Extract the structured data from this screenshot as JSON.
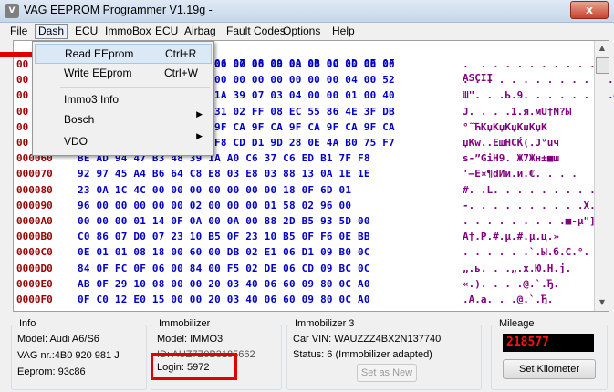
{
  "window": {
    "title": "VAG EEPROM Programmer  V1.19g -",
    "close_glyph": "x",
    "app_icon_text": "V"
  },
  "menubar": {
    "items": [
      "File",
      "Dash",
      "ECU",
      "ImmoBox",
      "ECU",
      "Airbag",
      "Fault Codes",
      "Options",
      "Help"
    ]
  },
  "dash_menu": {
    "items": [
      {
        "label": "Read EEprom",
        "shortcut": "Ctrl+R",
        "submenu": false
      },
      {
        "label": "Write EEprom",
        "shortcut": "Ctrl+W",
        "submenu": false
      },
      {
        "label": "Immo3 Info",
        "shortcut": "",
        "submenu": false
      },
      {
        "label": "Bosch",
        "shortcut": "",
        "submenu": true
      },
      {
        "label": "VDO",
        "shortcut": "",
        "submenu": true
      }
    ],
    "submenu_glyph": "▶"
  },
  "hex_view": {
    "header": {
      "bytes": "06 07 08 09 0A 0B 0C 0D 0E 0F",
      "ascii": "ASCII"
    },
    "rows": [
      {
        "addr": "00",
        "bytes": "00 00 00 00 00 00 00 00 00 00",
        "ascii": ".  . . . . . . . . . . . . . ."
      },
      {
        "addr": "00",
        "bytes": "00 00 00 00 00 00 00 04 00 52",
        "ascii": ". . . . . . . . . . . . . . .R"
      },
      {
        "addr": "00",
        "bytes": "1A 39 07 03 04 00 00 01 00 40",
        "ascii": "Ш\". . .Ь.9. . . . . . . .@"
      },
      {
        "addr": "00",
        "bytes": "31 02 FF 08 EC 55 86 4E 3F DB",
        "ascii": "Ј. . . .1.я.мU†N?Ы"
      },
      {
        "addr": "00",
        "bytes": "9F CA 9F CA 9F CA 9F CA 9F CA",
        "ascii": "°˜ЋКџКџКџКџКџК"
      },
      {
        "addr": "00",
        "bytes": "F8 CD D1 9D 28 0E 4A B0 75 F7",
        "ascii": "џКw..EшНСЌ(.J°uч"
      },
      {
        "addr": "000060",
        "bytes": "BE AD 94 47 B3 48 39 1A A0 C6 37 C6 ED B1 7F F8",
        "ascii": "ѕ-”GiН9. Ж7Жн±■ш"
      },
      {
        "addr": "000070",
        "bytes": "92 97 45 A4 B6 64 C8 E8 03 E8 03 88 13 0A 1E 1E",
        "ascii": "'—E¤¶dИи.и.€. . . ."
      },
      {
        "addr": "000080",
        "bytes": "23 0A 1C 4C 00 00 00 00 00 00 00 18 0F 6D 01",
        "ascii": "#. .L. . . . . . . . .m."
      },
      {
        "addr": "000090",
        "bytes": "96 00 00 00 00 00 02 00 00 00 01 58 02 96 00",
        "ascii": "-. . . . . . . . . .X.-."
      },
      {
        "addr": "0000A0",
        "bytes": "00 00 00 01 14 0F 0A 00 0A 00 88 2D B5 93 5D 00",
        "ascii": ". . . . . . . . .■-µ\"]."
      },
      {
        "addr": "0000B0",
        "bytes": "C0 86 07 D0 07 23 10 B5 0F 23 10 B5 0F F6 0E BB",
        "ascii": "А†.Р.#.µ.#.µ.ц.»"
      },
      {
        "addr": "0000C0",
        "bytes": "0E 01 01 08 18 00 60 00 DB 02 E1 06 D1 09 B0 0C",
        "ascii": ". . . . . .`.Ы.б.С.°."
      },
      {
        "addr": "0000D0",
        "bytes": "84 0F FC 0F 06 00 84 00 F5 02 DE 06 CD 09 BC 0C",
        "ascii": "„.ь. . .„.х.Ю.Н.ј."
      },
      {
        "addr": "0000E0",
        "bytes": "AB 0F 29 10 08 00 00 20 03 40 06 60 09 80 0C A0",
        "ascii": "«.). . . .@.`.Ђ. "
      },
      {
        "addr": "0000F0",
        "bytes": "0F C0 12 E0 15 00 00 20 03 40 06 60 09 80 0C A0",
        "ascii": ".А.а. . .@.`.Ђ. "
      }
    ],
    "scroll_up_glyph": "▲",
    "scroll_down_glyph": "▼"
  },
  "info": {
    "title": "Info",
    "model": "Model:  Audi A6/S6",
    "vag_nr": "VAG nr.:4B0 920 981 J",
    "eeprom": "Eeprom: 93c86"
  },
  "immobilizer": {
    "title": "Immobilizer",
    "model": "Model:   IMMO3",
    "id": "ID: AUZ7Z0B3185662",
    "login": "Login: 5972"
  },
  "immobilizer3": {
    "title": "Immobilizer 3",
    "car_vin": "Car VIN:  WAUZZZ4BX2N137740",
    "status": "Status: 6 (Immobilizer adapted)",
    "set_as_new": "Set as New"
  },
  "mileage": {
    "title": "Mileage",
    "value": "218577",
    "set_button": "Set Kilometer"
  },
  "colors": {
    "address": "#9a0000",
    "bytes": "#0000c8",
    "ascii": "#800080",
    "highlight_box": "#e00000",
    "arrow": "#e00000"
  }
}
